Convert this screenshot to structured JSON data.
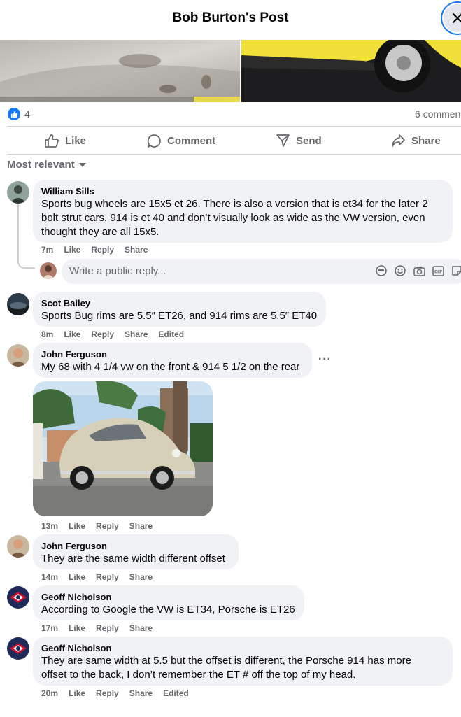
{
  "header": {
    "title": "Bob Burton's Post"
  },
  "reactions": {
    "count": "4",
    "comments_count": "6 commen"
  },
  "actions": {
    "like": "Like",
    "comment": "Comment",
    "send": "Send",
    "share": "Share"
  },
  "sort": {
    "label": "Most relevant"
  },
  "reply_box": {
    "placeholder": "Write a public reply..."
  },
  "comments": [
    {
      "author": "William Sills",
      "lines": [
        "Sports bug wheels are 15x5 et 26. There is also a version that is et34 for the later 2",
        "bolt strut cars. 914 is et 40 and don’t visually look as wide as the VW version, even",
        "thought they are all 15x5."
      ],
      "meta": [
        "7m",
        "Like",
        "Reply",
        "Share"
      ]
    },
    {
      "author": "Scot Bailey",
      "lines": [
        "Sports Bug rims are 5.5″ ET26, and 914 rims are 5.5″ ET40"
      ],
      "meta": [
        "8m",
        "Like",
        "Reply",
        "Share",
        "Edited"
      ]
    },
    {
      "author": "John Ferguson",
      "lines": [
        "My 68 with 4 1/4 vw on the front & 914 5 1/2 on the rear"
      ],
      "meta": [
        "13m",
        "Like",
        "Reply",
        "Share"
      ]
    },
    {
      "author": "John Ferguson",
      "lines": [
        "They are the same width different offset"
      ],
      "meta": [
        "14m",
        "Like",
        "Reply",
        "Share"
      ]
    },
    {
      "author": "Geoff Nicholson",
      "lines": [
        "According to Google the VW is ET34, Porsche is ET26"
      ],
      "meta": [
        "17m",
        "Like",
        "Reply",
        "Share"
      ]
    },
    {
      "author": "Geoff Nicholson",
      "lines": [
        "They are same width at 5.5 but the offset is different, the Porsche 914 has more",
        "offset to the back, I don’t remember the ET # off the top of my head."
      ],
      "meta": [
        "20m",
        "Like",
        "Reply",
        "Share",
        "Edited"
      ]
    }
  ],
  "colors": {
    "accent": "#1877f2",
    "bubble": "#f0f2f5",
    "muted": "#65676b"
  }
}
